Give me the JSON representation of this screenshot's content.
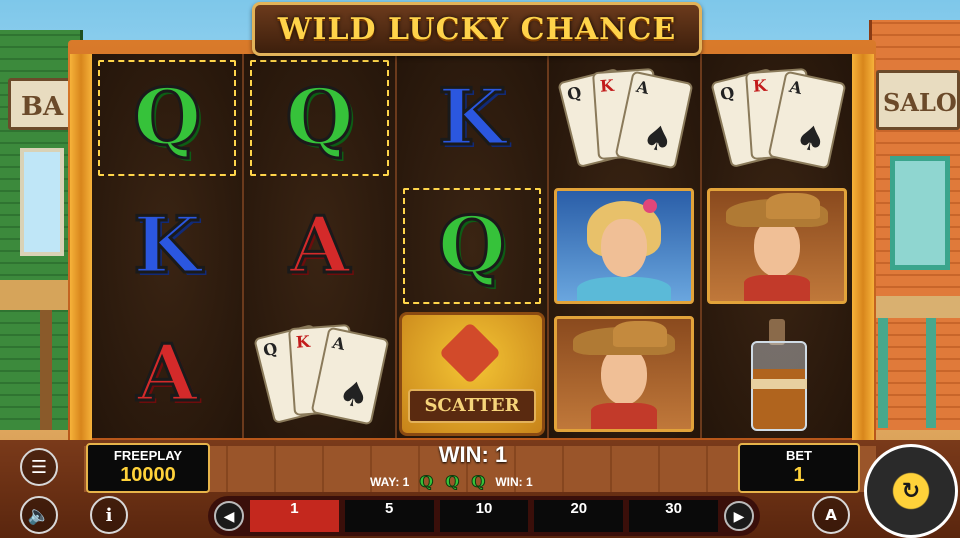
{
  "game": {
    "title": "WILD LUCKY CHANCE"
  },
  "background": {
    "left_sign": "BA",
    "right_sign": "SALO"
  },
  "reels": [
    [
      {
        "symbol": "Q",
        "type": "letter",
        "win": true
      },
      {
        "symbol": "K",
        "type": "letter",
        "win": false
      },
      {
        "symbol": "A",
        "type": "letter",
        "win": false
      }
    ],
    [
      {
        "symbol": "Q",
        "type": "letter",
        "win": true
      },
      {
        "symbol": "A",
        "type": "letter",
        "win": false
      },
      {
        "symbol": "cards",
        "type": "cards",
        "win": false
      }
    ],
    [
      {
        "symbol": "K",
        "type": "letter",
        "win": false
      },
      {
        "symbol": "Q",
        "type": "letter",
        "win": true
      },
      {
        "symbol": "SCATTER",
        "type": "scatter",
        "win": false
      }
    ],
    [
      {
        "symbol": "cards",
        "type": "cards",
        "win": false
      },
      {
        "symbol": "woman",
        "type": "portrait",
        "win": false
      },
      {
        "symbol": "cowboy",
        "type": "portrait",
        "win": false
      }
    ],
    [
      {
        "symbol": "cards",
        "type": "cards",
        "win": false
      },
      {
        "symbol": "cowboy",
        "type": "portrait",
        "win": false
      },
      {
        "symbol": "bottle",
        "type": "bottle",
        "win": false
      }
    ]
  ],
  "card_fan": {
    "c1_rank": "Q",
    "c2_rank": "K",
    "c3_rank": "A",
    "c1_suit": "♠",
    "c2_suit": "♥",
    "c3_suit": "♠"
  },
  "scatter_label": "SCATTER",
  "hud": {
    "freeplay_label": "FREEPLAY",
    "freeplay_value": "10000",
    "bet_label": "BET",
    "bet_value": "1",
    "win_title": "WIN: 1",
    "way_label": "WAY: 1",
    "win_small": "WIN: 1",
    "win_symbols": [
      "Q",
      "Q",
      "Q"
    ],
    "bet_options": [
      "1",
      "5",
      "10",
      "20",
      "30"
    ],
    "bet_selected_index": 0,
    "prev_icon": "◀",
    "next_icon": "▶",
    "menu_icon": "☰",
    "sound_icon": "🔈",
    "info_icon": "i",
    "auto_icon": "A",
    "spin_icon": "↻"
  },
  "colors": {
    "accent_gold": "#e7b44a",
    "active_bet": "#c4281e",
    "q_green": "#36c23a",
    "k_blue": "#2b57e0",
    "a_red": "#d42a2a"
  }
}
